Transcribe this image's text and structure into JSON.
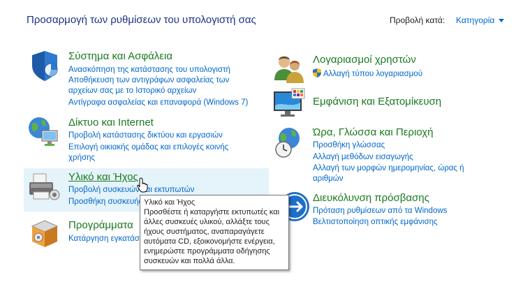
{
  "header": {
    "title": "Προσαρμογή των ρυθμίσεων του υπολογιστή σας",
    "view_by_label": "Προβολή κατά:",
    "view_by_value": "Κατηγορία"
  },
  "categories": [
    {
      "title": "Σύστημα και Ασφάλεια",
      "icon": "shield-security-icon",
      "links": [
        "Ανασκόπηση της κατάστασης του υπολογιστή",
        "Αποθήκευση των αντιγράφων ασφαλείας των αρχείων σας με το Ιστορικό αρχείων",
        "Αντίγραφα ασφαλείας και επαναφορά (Windows 7)"
      ]
    },
    {
      "title": "Δίκτυο και Internet",
      "icon": "network-globe-icon",
      "links": [
        "Προβολή κατάστασης δικτύου και εργασιών",
        "Επιλογή οικιακής ομάδας και επιλογές κοινής χρήσης"
      ]
    },
    {
      "title": "Υλικό και Ήχος",
      "icon": "printer-hardware-icon",
      "links": [
        "Προβολή συσκευών και εκτυπωτών",
        "Προσθήκη συσκευής"
      ]
    },
    {
      "title": "Προγράμματα",
      "icon": "programs-box-icon",
      "links": [
        "Κατάργηση εγκατάστασης προγράμματος"
      ]
    },
    {
      "title": "Λογαριασμοί χρηστών",
      "icon": "user-accounts-icon",
      "links": [
        "Αλλαγή τύπου λογαριασμού"
      ]
    },
    {
      "title": "Εμφάνιση και Εξατομίκευση",
      "icon": "monitor-appearance-icon",
      "links": []
    },
    {
      "title": "Ώρα, Γλώσσα και Περιοχή",
      "icon": "clock-globe-icon",
      "links": [
        "Προσθήκη γλώσσας",
        "Αλλαγή μεθόδων εισαγωγής",
        "Αλλαγή των μορφών ημερομηνίας, ώρας ή αριθμών"
      ]
    },
    {
      "title": "Διευκόλυνση πρόσβασης",
      "icon": "ease-of-access-icon",
      "links": [
        "Πρόταση ρυθμίσεων από τα Windows",
        "Βελτιστοποίηση οπτικής εμφάνισης"
      ]
    }
  ],
  "tooltip": {
    "title": "Υλικό και Ήχος",
    "body": "Προσθέστε ή καταργήστε εκτυπωτές και άλλες συσκευές υλικού, αλλάξτε τους ήχους συστήματος, αναπαραγάγετε αυτόματα CD, εξοικονομήστε ενέργεια, ενημερώστε προγράμματα οδήγησης συσκευών και πολλά άλλα."
  }
}
